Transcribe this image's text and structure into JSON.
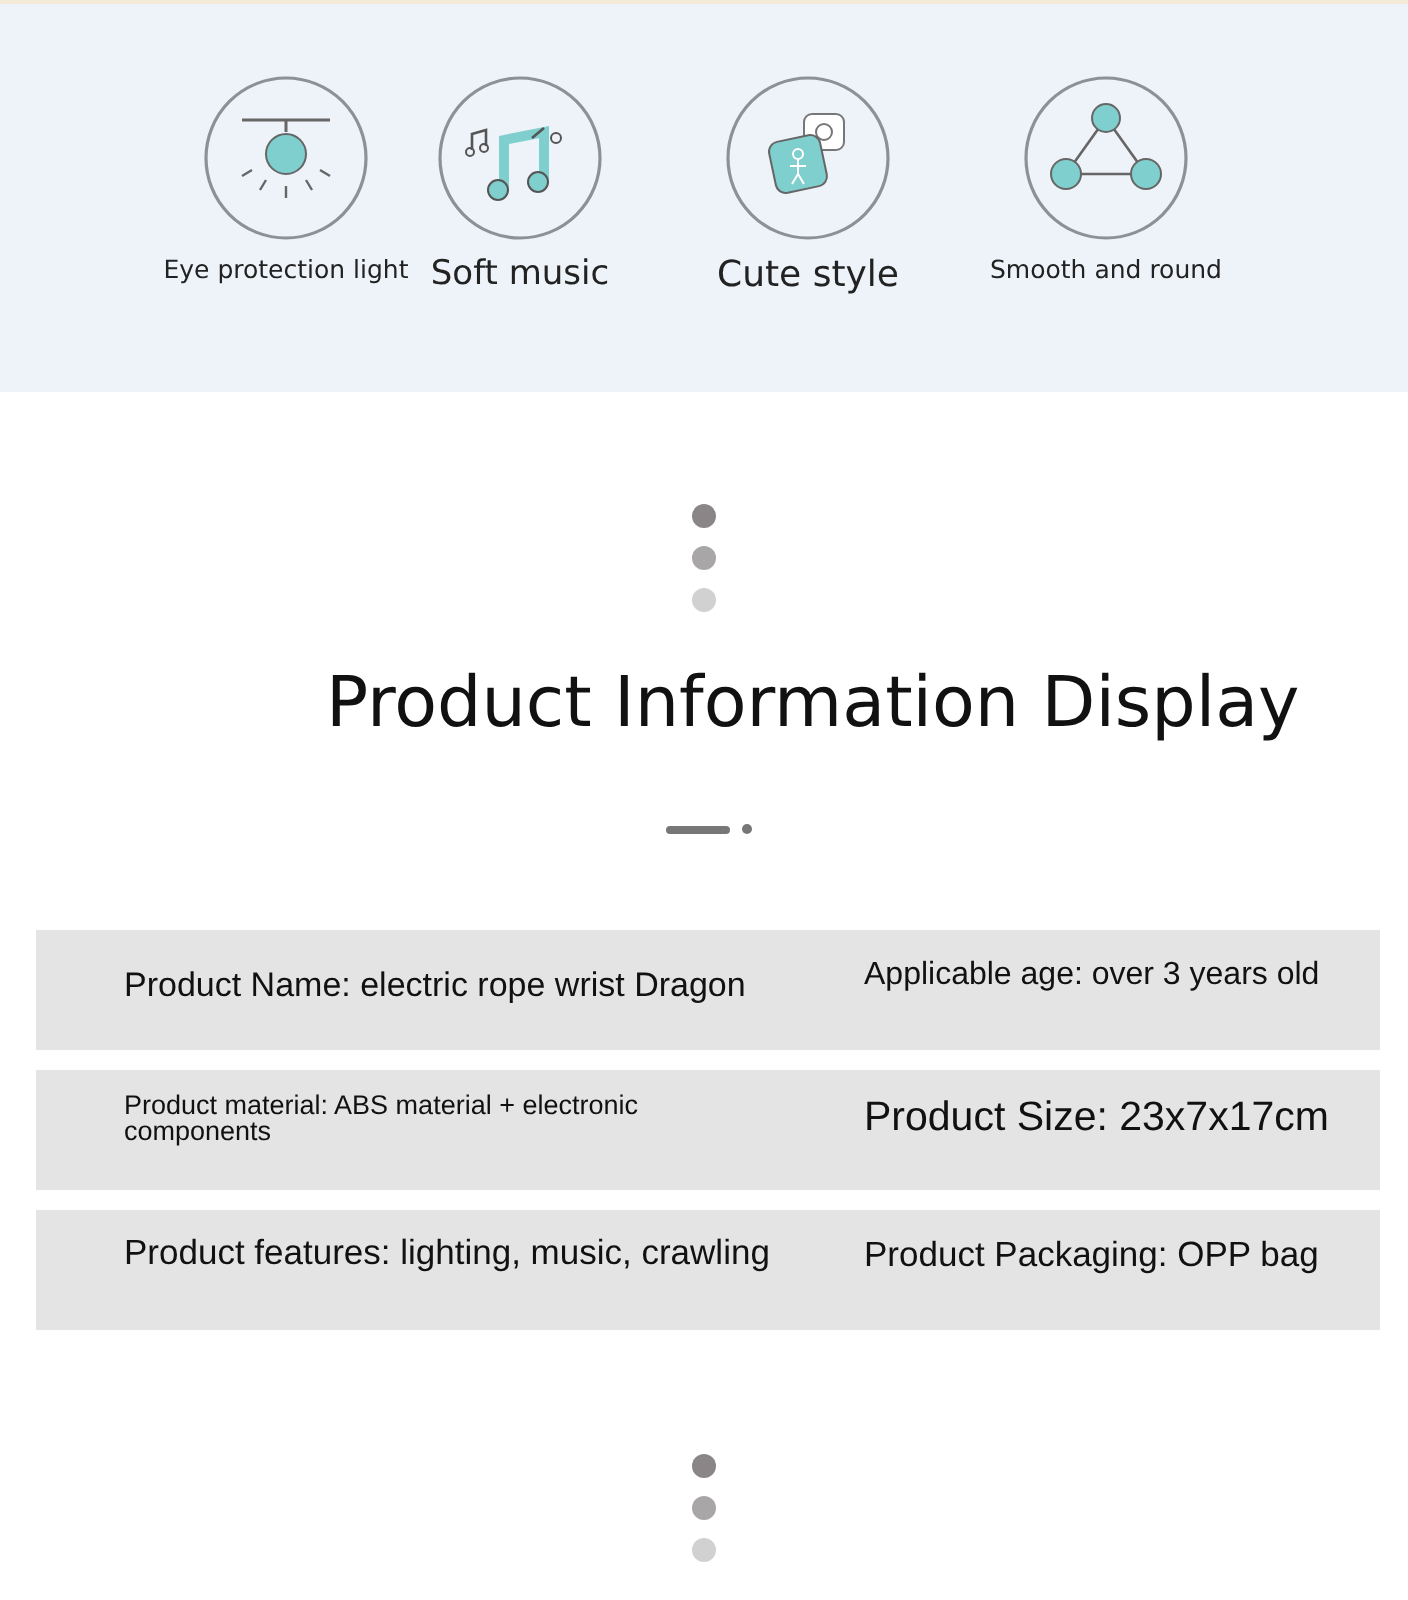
{
  "features": [
    {
      "kind": "lamp",
      "label": "Eye protection light"
    },
    {
      "kind": "music",
      "label": "Soft music"
    },
    {
      "kind": "cute",
      "label": "Cute style"
    },
    {
      "kind": "round",
      "label": "Smooth and round"
    }
  ],
  "section_title": "Product Information Display",
  "info_rows": [
    {
      "left": "Product Name: electric rope wrist Dragon",
      "right": "Applicable age: over 3 years old"
    },
    {
      "left": "Product material: ABS material + electronic components",
      "right": "Product Size: 23x7x17cm"
    },
    {
      "left": "Product features: lighting, music, crawling",
      "right": "Product Packaging: OPP bag"
    }
  ]
}
